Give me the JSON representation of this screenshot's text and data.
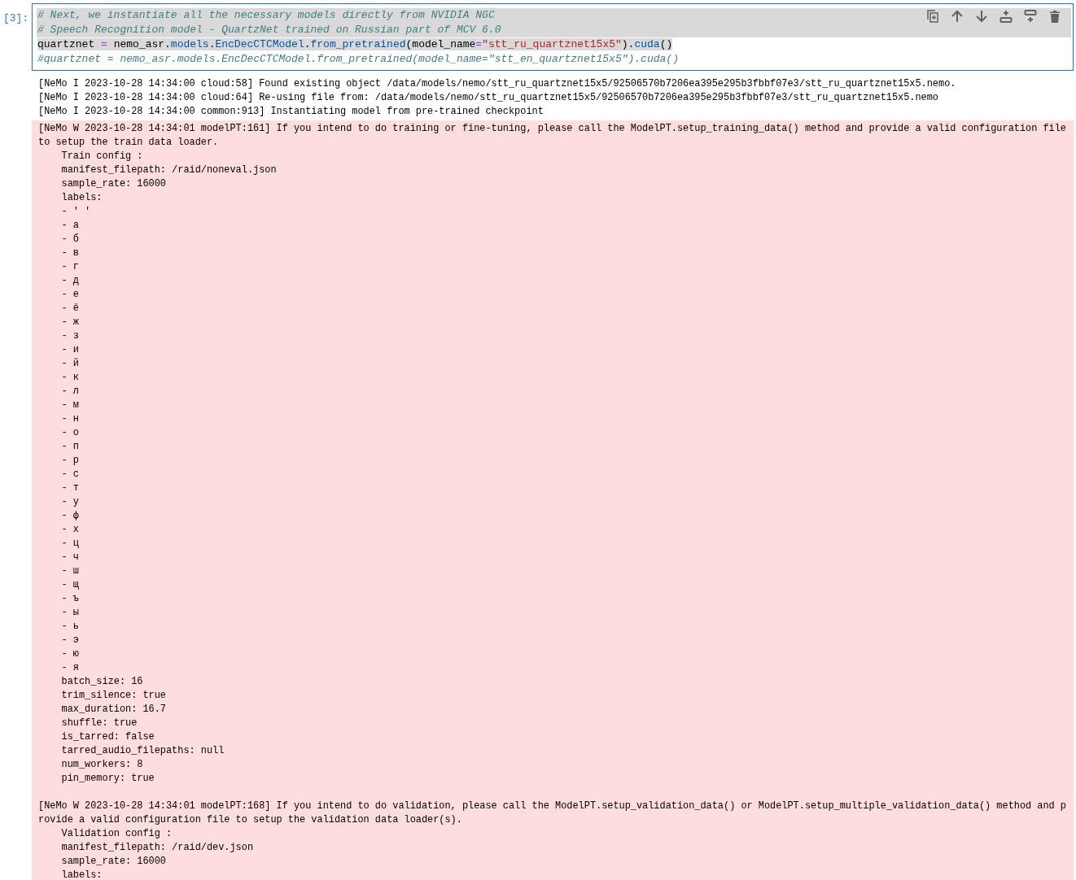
{
  "cell": {
    "prompt": "[3]:",
    "code_lines": [
      {
        "selected": true,
        "full_width": true,
        "tokens": [
          {
            "kind": "comment",
            "text": "# Next, we instantiate all the necessary models directly from NVIDIA NGC"
          }
        ]
      },
      {
        "selected": true,
        "full_width": true,
        "tokens": [
          {
            "kind": "comment",
            "text": "# Speech Recognition model - QuartzNet trained on Russian part of MCV 6.0"
          }
        ]
      },
      {
        "selected": true,
        "full_width": false,
        "tokens": [
          {
            "kind": "name",
            "text": "quartznet "
          },
          {
            "kind": "operator",
            "text": "="
          },
          {
            "kind": "name",
            "text": " nemo_asr."
          },
          {
            "kind": "attr",
            "text": "models"
          },
          {
            "kind": "name",
            "text": "."
          },
          {
            "kind": "attr",
            "text": "EncDecCTCModel"
          },
          {
            "kind": "name",
            "text": "."
          },
          {
            "kind": "attr",
            "text": "from_pretrained"
          },
          {
            "kind": "name",
            "text": "(model_name"
          },
          {
            "kind": "operator",
            "text": "="
          },
          {
            "kind": "string",
            "text": "\"stt_ru_quartznet15x5\""
          },
          {
            "kind": "name",
            "text": ")."
          },
          {
            "kind": "attr",
            "text": "cuda"
          },
          {
            "kind": "name",
            "text": "()"
          }
        ]
      },
      {
        "selected": false,
        "tokens": [
          {
            "kind": "comment",
            "text": "#quartznet = nemo_asr.models.EncDecCTCModel.from_pretrained(model_name=\"stt_en_quartznet15x5\").cuda()"
          }
        ]
      }
    ],
    "toolbar": [
      {
        "kind": "duplicate"
      },
      {
        "kind": "move-up"
      },
      {
        "kind": "move-down"
      },
      {
        "kind": "insert-above"
      },
      {
        "kind": "insert-below"
      },
      {
        "kind": "delete"
      }
    ]
  },
  "outputs": [
    {
      "kind": "stdout",
      "paragraphs": [
        [
          "[NeMo I 2023-10-28 14:34:00 cloud:58] Found existing object /data/models/nemo/stt_ru_quartznet15x5/92506570b7206ea395e295b3fbbf07e3/stt_ru_quartznet15x5.nemo.",
          "[NeMo I 2023-10-28 14:34:00 cloud:64] Re-using file from: /data/models/nemo/stt_ru_quartznet15x5/92506570b7206ea395e295b3fbbf07e3/stt_ru_quartznet15x5.nemo",
          "[NeMo I 2023-10-28 14:34:00 common:913] Instantiating model from pre-trained checkpoint"
        ]
      ]
    },
    {
      "kind": "stderr",
      "paragraphs": [
        [
          "[NeMo W 2023-10-28 14:34:01 modelPT:161] If you intend to do training or fine-tuning, please call the ModelPT.setup_training_data() method and provide a valid configuration file to setup the train data loader.",
          "    Train config :",
          "    manifest_filepath: /raid/noneval.json",
          "    sample_rate: 16000",
          "    labels:",
          "    - ' '",
          "    - а",
          "    - б",
          "    - в",
          "    - г",
          "    - д",
          "    - е",
          "    - ё",
          "    - ж",
          "    - з",
          "    - и",
          "    - й",
          "    - к",
          "    - л",
          "    - м",
          "    - н",
          "    - о",
          "    - п",
          "    - р",
          "    - с",
          "    - т",
          "    - у",
          "    - ф",
          "    - х",
          "    - ц",
          "    - ч",
          "    - ш",
          "    - щ",
          "    - ъ",
          "    - ы",
          "    - ь",
          "    - э",
          "    - ю",
          "    - я",
          "    batch_size: 16",
          "    trim_silence: true",
          "    max_duration: 16.7",
          "    shuffle: true",
          "    is_tarred: false",
          "    tarred_audio_filepaths: null",
          "    num_workers: 8",
          "    pin_memory: true"
        ],
        [
          "[NeMo W 2023-10-28 14:34:01 modelPT:168] If you intend to do validation, please call the ModelPT.setup_validation_data() or ModelPT.setup_multiple_validation_data() method and provide a valid configuration file to setup the validation data loader(s).",
          "    Validation config :",
          "    manifest_filepath: /raid/dev.json",
          "    sample_rate: 16000",
          "    labels:"
        ]
      ]
    }
  ]
}
